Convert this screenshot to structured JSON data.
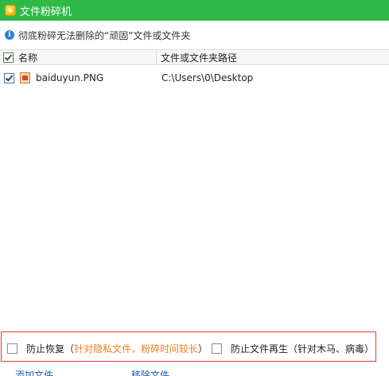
{
  "window": {
    "title": "文件粉碎机"
  },
  "info": {
    "text": "彻底粉碎无法删除的“顽固”文件或文件夹"
  },
  "table": {
    "columns": [
      "名称",
      "文件或文件夹路径"
    ],
    "rows": [
      {
        "name": "baiduyun.PNG",
        "path": "C:\\Users\\0\\Desktop",
        "checked": true
      }
    ]
  },
  "options": {
    "prevent_recovery": {
      "label": "防止恢复",
      "open": "（",
      "hint": "针对隐私文件，粉碎时间较长",
      "close": "）"
    },
    "prevent_regeneration": {
      "label": "防止文件再生",
      "open": "（",
      "hint": "针对木马、病毒",
      "close": "）"
    }
  },
  "actions": {
    "add_file": "添加文件",
    "remove_file": "移除文件"
  },
  "colors": {
    "titlebar": "#2fba47",
    "accent_orange": "#f07f1a",
    "highlight_border": "#e03a3a",
    "link": "#1a5fb4"
  }
}
